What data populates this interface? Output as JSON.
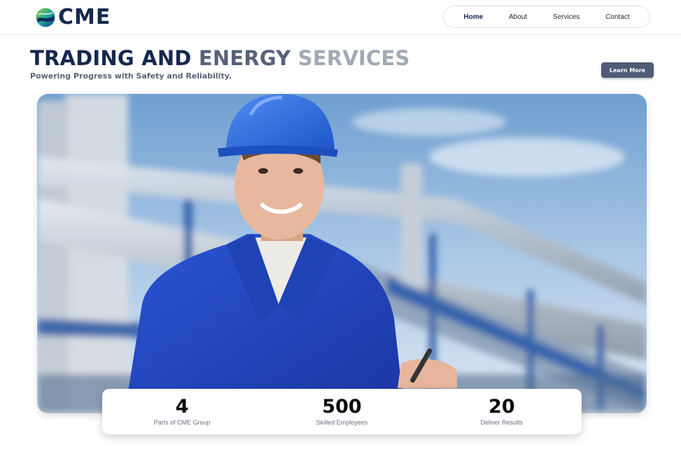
{
  "header": {
    "logo_text": "CME",
    "nav": [
      {
        "label": "Home",
        "active": true
      },
      {
        "label": "About",
        "active": false
      },
      {
        "label": "Services",
        "active": false
      },
      {
        "label": "Contact",
        "active": false
      }
    ]
  },
  "hero": {
    "title_part1": "TRADING AND ",
    "title_part2": "ENERGY ",
    "title_part3": "SERVICES",
    "subtitle": "Powering Progress with Safety and Reliability.",
    "cta_label": "Learn More",
    "image": "worker-in-hard-hat-industrial-pipes-photo"
  },
  "stats": [
    {
      "value": "4",
      "label": "Parts of CME Group"
    },
    {
      "value": "500",
      "label": "Skilled Employees"
    },
    {
      "value": "20",
      "label": "Deliver Results"
    }
  ],
  "colors": {
    "brand_navy": "#16284e",
    "button": "#505c75",
    "title_mid": "#56627a",
    "title_light": "#a2a9b5"
  }
}
